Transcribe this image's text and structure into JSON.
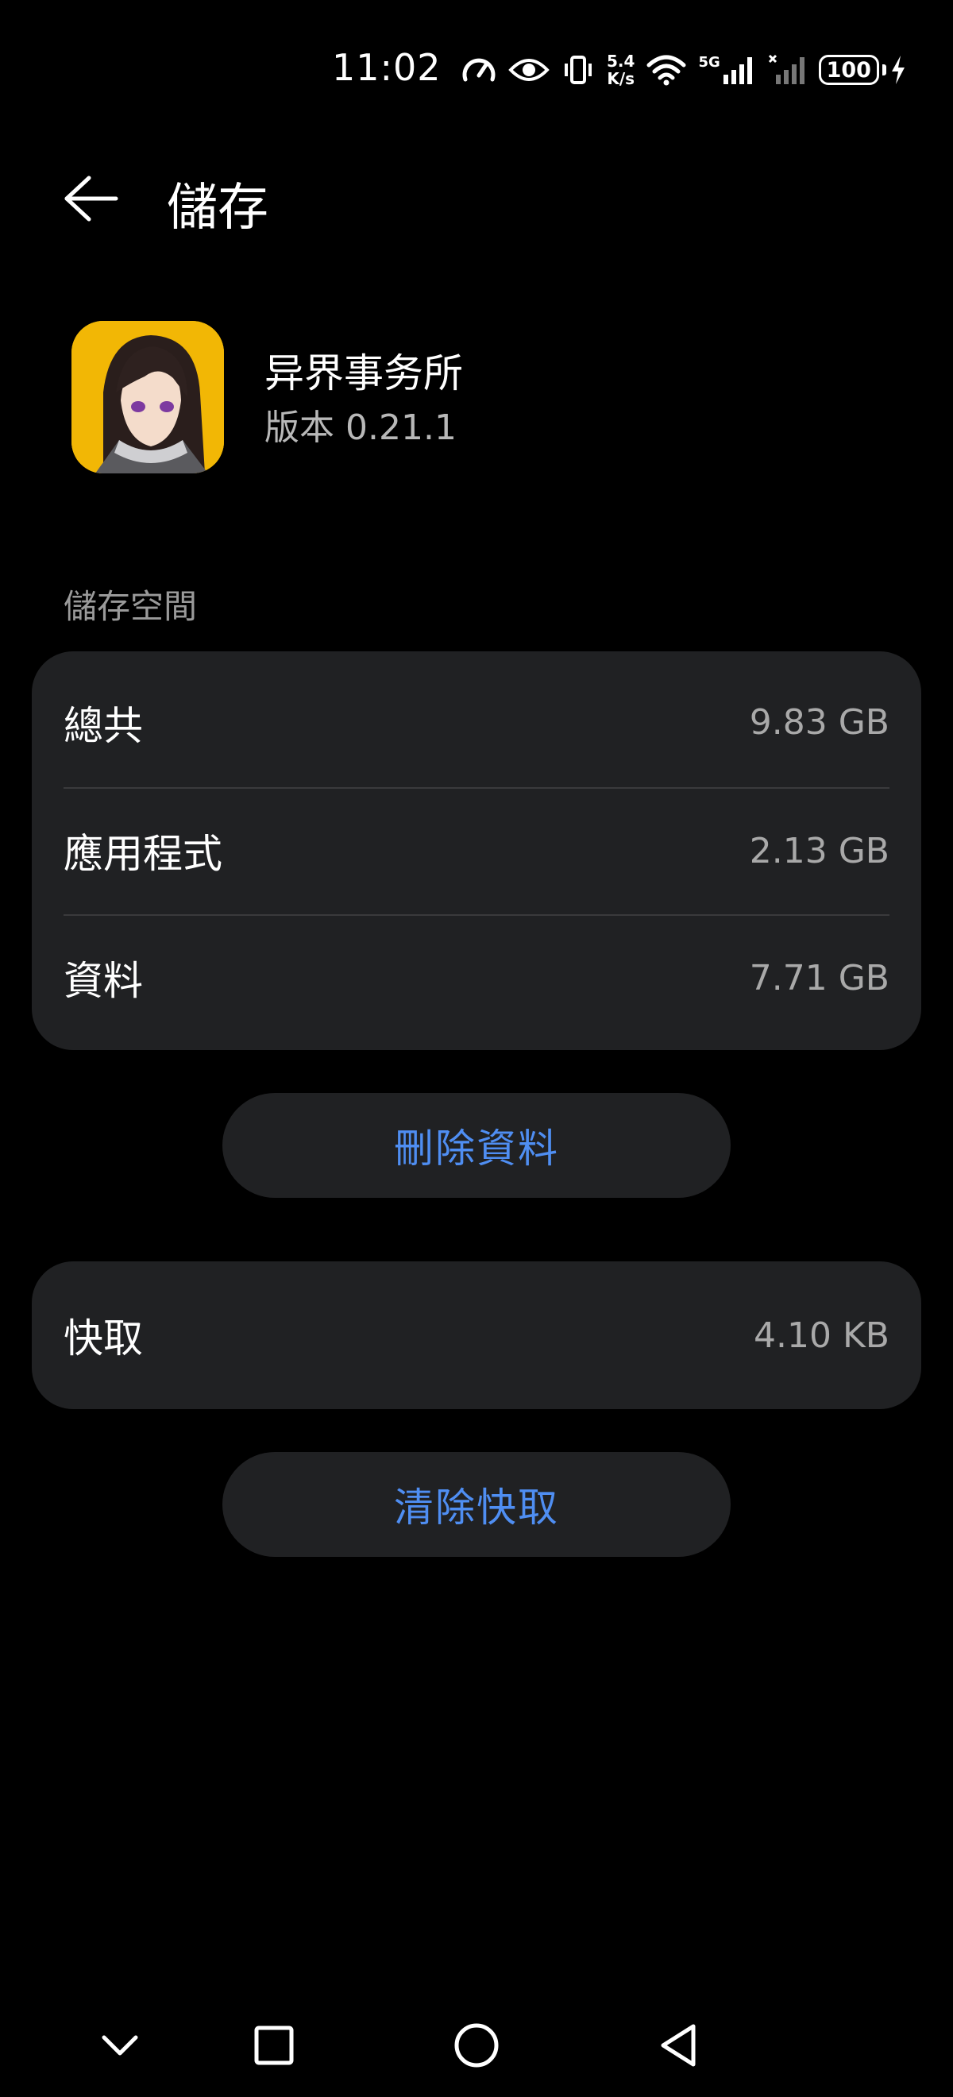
{
  "status_bar": {
    "time": "11:02",
    "net_speed_value": "5.4",
    "net_speed_unit": "K/s",
    "signal_label": "5G",
    "battery": "100"
  },
  "header": {
    "title": "儲存"
  },
  "app": {
    "name": "异界事务所",
    "version": "版本 0.21.1"
  },
  "storage": {
    "section_label": "儲存空間",
    "rows": [
      {
        "label": "總共",
        "value": "9.83 GB"
      },
      {
        "label": "應用程式",
        "value": "2.13 GB"
      },
      {
        "label": "資料",
        "value": "7.71 GB"
      }
    ],
    "delete_button": "刪除資料"
  },
  "cache": {
    "label": "快取",
    "value": "4.10 KB",
    "clear_button": "清除快取"
  },
  "colors": {
    "accent": "#4f8ef2",
    "card": "#202123",
    "background": "#000000"
  },
  "nav": {
    "icons": [
      "chevron-down-icon",
      "recents-square-icon",
      "home-circle-icon",
      "back-triangle-icon"
    ]
  }
}
